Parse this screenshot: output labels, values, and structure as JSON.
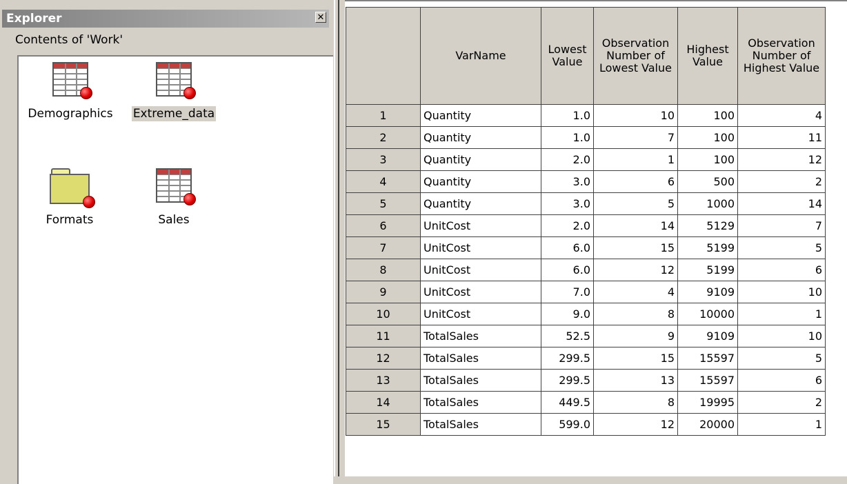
{
  "explorer": {
    "title": "Explorer",
    "close_glyph": "✕",
    "contents_label": "Contents of 'Work'",
    "items": [
      {
        "label": "Demographics",
        "icon": "dataset-icon",
        "selected": false
      },
      {
        "label": "Extreme_data",
        "icon": "dataset-icon",
        "selected": true
      },
      {
        "label": "Formats",
        "icon": "folder-icon",
        "selected": false
      },
      {
        "label": "Sales",
        "icon": "dataset-icon",
        "selected": false
      }
    ]
  },
  "table": {
    "headers": [
      "",
      "VarName",
      "Lowest Value",
      "Observation Number of Lowest Value",
      "Highest Value",
      "Observation Number of Highest Value"
    ],
    "rows": [
      [
        "1",
        "Quantity",
        "1.0",
        "10",
        "100",
        "4"
      ],
      [
        "2",
        "Quantity",
        "1.0",
        "7",
        "100",
        "11"
      ],
      [
        "3",
        "Quantity",
        "2.0",
        "1",
        "100",
        "12"
      ],
      [
        "4",
        "Quantity",
        "3.0",
        "6",
        "500",
        "2"
      ],
      [
        "5",
        "Quantity",
        "3.0",
        "5",
        "1000",
        "14"
      ],
      [
        "6",
        "UnitCost",
        "2.0",
        "14",
        "5129",
        "7"
      ],
      [
        "7",
        "UnitCost",
        "6.0",
        "15",
        "5199",
        "5"
      ],
      [
        "8",
        "UnitCost",
        "6.0",
        "12",
        "5199",
        "6"
      ],
      [
        "9",
        "UnitCost",
        "7.0",
        "4",
        "9109",
        "10"
      ],
      [
        "10",
        "UnitCost",
        "9.0",
        "8",
        "10000",
        "1"
      ],
      [
        "11",
        "TotalSales",
        "52.5",
        "9",
        "9109",
        "10"
      ],
      [
        "12",
        "TotalSales",
        "299.5",
        "15",
        "15597",
        "5"
      ],
      [
        "13",
        "TotalSales",
        "299.5",
        "13",
        "15597",
        "6"
      ],
      [
        "14",
        "TotalSales",
        "449.5",
        "8",
        "19995",
        "2"
      ],
      [
        "15",
        "TotalSales",
        "599.0",
        "12",
        "20000",
        "1"
      ]
    ]
  }
}
